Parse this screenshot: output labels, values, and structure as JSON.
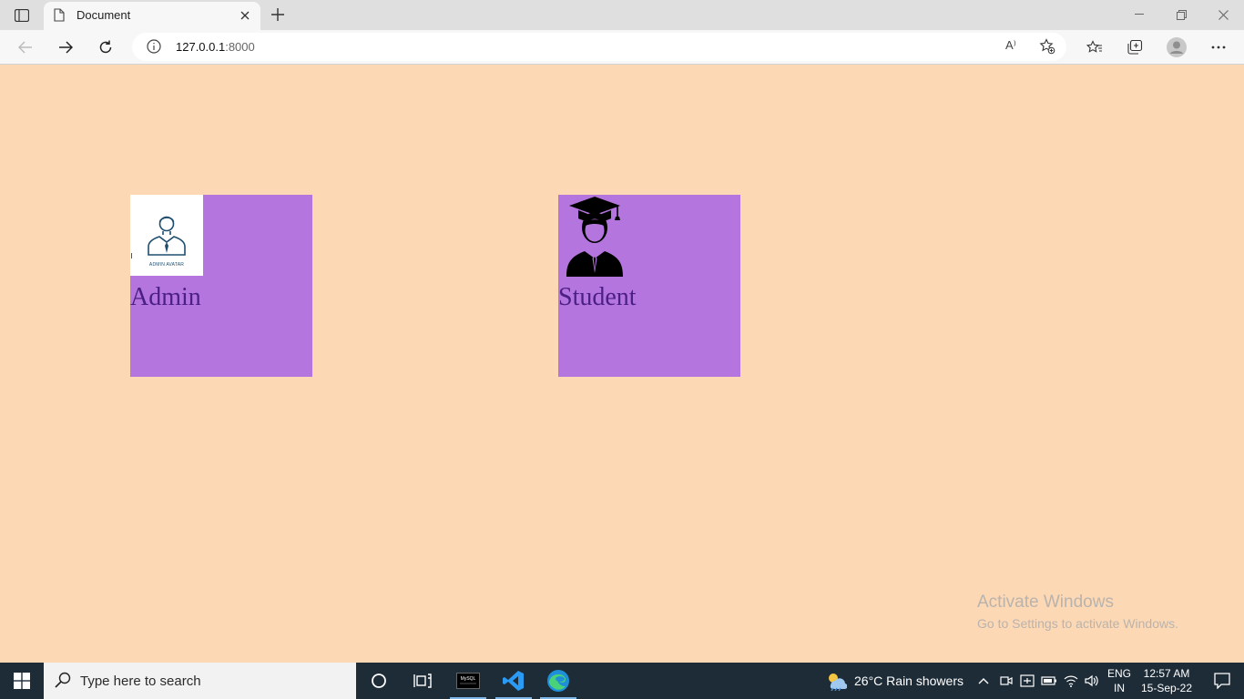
{
  "browser": {
    "tab_title": "Document",
    "url_host": "127.0.0.1",
    "url_port": ":8000",
    "read_aloud_label": "A⁾"
  },
  "page": {
    "admin": {
      "label": "Admin",
      "avatar_caption": "ADMIN AVATAR"
    },
    "student": {
      "label": "Student"
    },
    "watermark": {
      "title": "Activate Windows",
      "subtitle": "Go to Settings to activate Windows."
    }
  },
  "taskbar": {
    "search_placeholder": "Type here to search",
    "weather": "26°C  Rain showers",
    "lang_top": "ENG",
    "lang_bottom": "IN",
    "time": "12:57 AM",
    "date": "15-Sep-22",
    "app_label": "MySQL"
  },
  "colors": {
    "page_bg": "#fdd8b5",
    "card_bg": "#b476de",
    "label_color": "#4b1f86",
    "taskbar_bg": "#1e2c38"
  }
}
